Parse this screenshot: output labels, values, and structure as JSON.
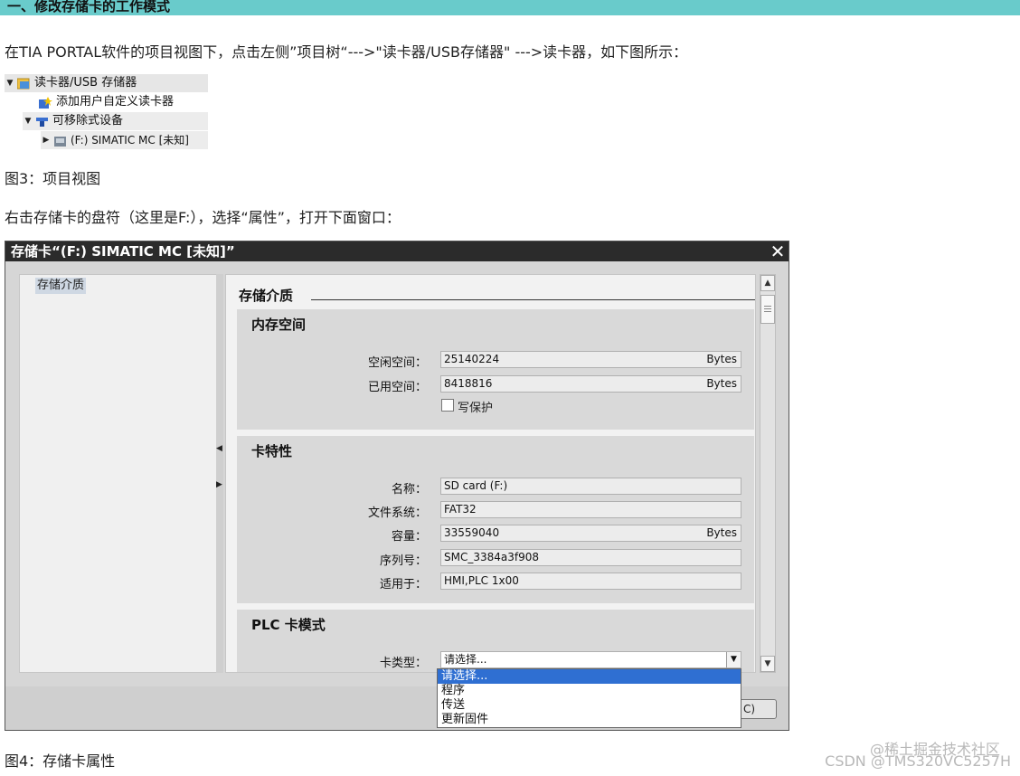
{
  "header": {
    "title": "一、修改存储卡的工作模式"
  },
  "intro_text": "在TIA PORTAL软件的项目视图下，点击左侧”项目树“--->\"读卡器/USB存储器\" --->读卡器，如下图所示：",
  "tree": {
    "items": [
      {
        "label": "读卡器/USB 存储器"
      },
      {
        "label": "添加用户自定义读卡器"
      },
      {
        "label": "可移除式设备"
      },
      {
        "label": "(F:) SIMATIC MC [未知]"
      }
    ]
  },
  "caption3": "图3：项目视图",
  "instruction_text": "右击存储卡的盘符（这里是F:），选择“属性”，打开下面窗口：",
  "dialog": {
    "title": "存储卡“(F:) SIMATIC MC [未知]”",
    "close": "✕",
    "nav_item": "存储介质",
    "section_title": "存储介质",
    "memory": {
      "title": "内存空间",
      "free_label": "空闲空间：",
      "free_value": "25140224",
      "free_unit": "Bytes",
      "used_label": "已用空间：",
      "used_value": "8418816",
      "used_unit": "Bytes",
      "write_protect_label": "写保护"
    },
    "card_props": {
      "title": "卡特性",
      "name_label": "名称：",
      "name_value": "SD card (F:)",
      "fs_label": "文件系统：",
      "fs_value": "FAT32",
      "capacity_label": "容量：",
      "capacity_value": "33559040",
      "capacity_unit": "Bytes",
      "serial_label": "序列号：",
      "serial_value": "SMC_3384a3f908",
      "applies_label": "适用于：",
      "applies_value": "HMI,PLC 1x00"
    },
    "plc_mode": {
      "title": "PLC 卡模式",
      "card_type_label": "卡类型：",
      "card_type_value": "请选择..."
    },
    "ok_label": "C)"
  },
  "dropdown": {
    "options": [
      "请选择...",
      "程序",
      "传送",
      "更新固件"
    ],
    "selected_index": 0
  },
  "caption4": "图4：存储卡属性",
  "watermark1": "@稀土掘金技术社区",
  "watermark2": "CSDN @TMS320VC5257H"
}
